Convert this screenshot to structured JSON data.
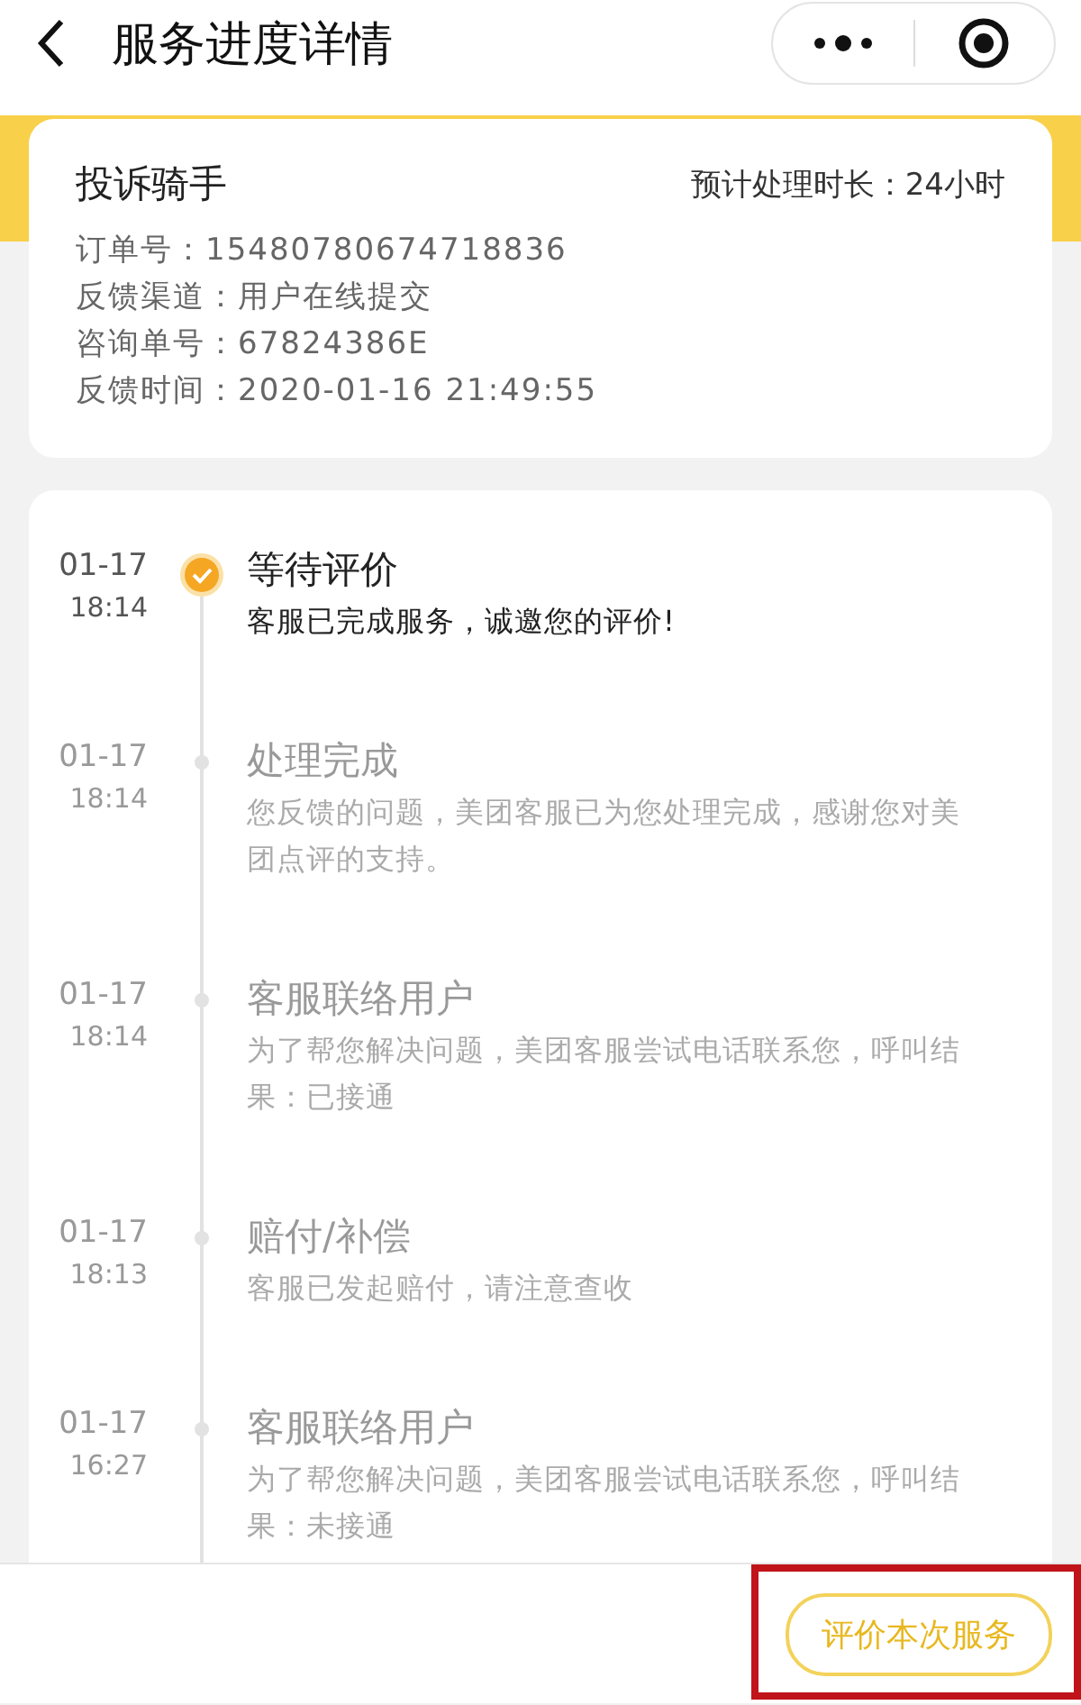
{
  "header": {
    "title": "服务进度详情"
  },
  "summary": {
    "title": "投诉骑手",
    "estimate": "预计处理时长：24小时",
    "fields": [
      {
        "label": "订单号：",
        "value": "15480780674718836"
      },
      {
        "label": "反馈渠道：",
        "value": "用户在线提交"
      },
      {
        "label": "咨询单号：",
        "value": "67824386E"
      },
      {
        "label": "反馈时间：",
        "value": "2020-01-16 21:49:55"
      }
    ]
  },
  "timeline": [
    {
      "date": "01-17",
      "time": "18:14",
      "title": "等待评价",
      "text": "客服已完成服务，诚邀您的评价!",
      "active": true
    },
    {
      "date": "01-17",
      "time": "18:14",
      "title": "处理完成",
      "text": "您反馈的问题，美团客服已为您处理完成，感谢您对美团点评的支持。",
      "active": false
    },
    {
      "date": "01-17",
      "time": "18:14",
      "title": "客服联络用户",
      "text": "为了帮您解决问题，美团客服尝试电话联系您，呼叫结果：已接通",
      "active": false
    },
    {
      "date": "01-17",
      "time": "18:13",
      "title": "赔付/补偿",
      "text": "客服已发起赔付，请注意查收",
      "active": false
    },
    {
      "date": "01-17",
      "time": "16:27",
      "title": "客服联络用户",
      "text": "为了帮您解决问题，美团客服尝试电话联系您，呼叫结果：未接通",
      "active": false
    }
  ],
  "footer": {
    "button": "评价本次服务",
    "highlighted": true
  }
}
